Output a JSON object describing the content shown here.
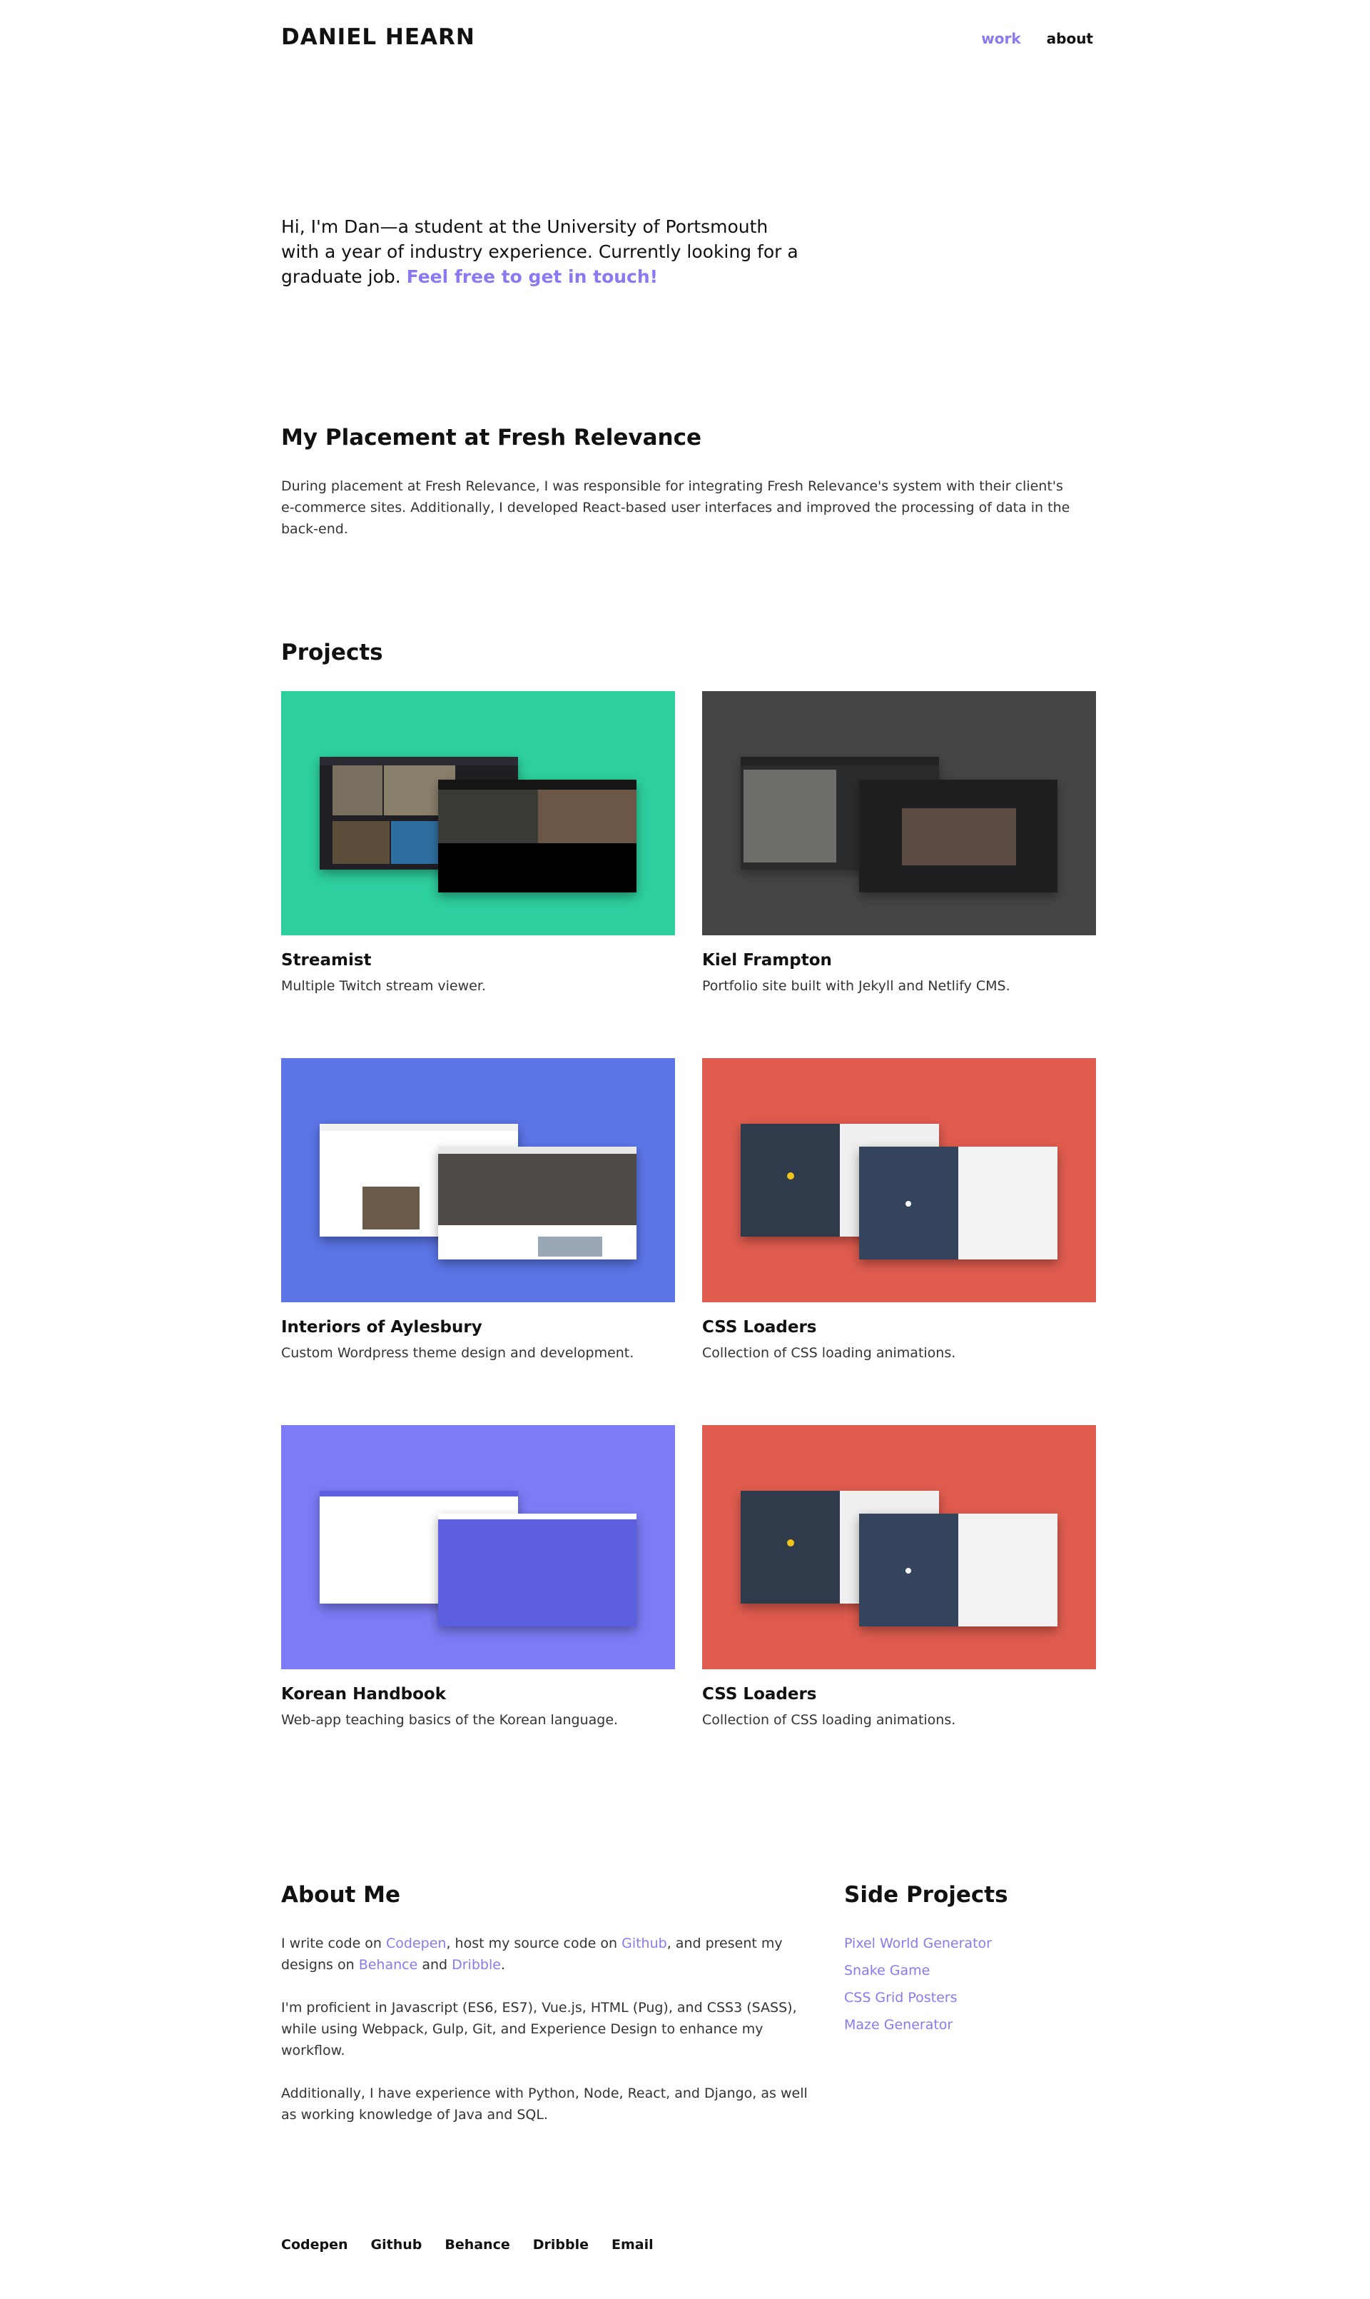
{
  "header": {
    "logo": "DANIEL HEARN",
    "nav": [
      {
        "label": "work",
        "active": true
      },
      {
        "label": "about",
        "active": false
      }
    ]
  },
  "intro": {
    "text": "Hi, I'm Dan—a student at the University of Portsmouth with a year of industry experience. Currently looking for a graduate job.",
    "cta": "Feel free to get in touch!"
  },
  "placement": {
    "heading": "My Placement at Fresh Relevance",
    "body": "During placement at Fresh Relevance, I was responsible for integrating Fresh Relevance's system with their client's e-commerce sites. Additionally, I developed React-based user interfaces and improved the processing of data in the back-end."
  },
  "projects": {
    "heading": "Projects",
    "items": [
      {
        "title": "Streamist",
        "desc": "Multiple Twitch stream viewer.",
        "bg": "#2ecf9e"
      },
      {
        "title": "Kiel Frampton",
        "desc": "Portfolio site built with Jekyll and Netlify CMS.",
        "bg": "#444547"
      },
      {
        "title": "Interiors of Aylesbury",
        "desc": "Custom Wordpress theme design and development.",
        "bg": "#5b75e6"
      },
      {
        "title": "CSS Loaders",
        "desc": "Collection of CSS loading animations.",
        "bg": "#e05c4f"
      },
      {
        "title": "Korean Handbook",
        "desc": "Web-app teaching basics of the Korean language.",
        "bg": "#7d7cf6"
      },
      {
        "title": "CSS Loaders",
        "desc": "Collection of CSS loading animations.",
        "bg": "#e05c4f"
      }
    ]
  },
  "about": {
    "heading": "About Me",
    "p1": {
      "t1": "I write code on ",
      "l1": "Codepen",
      "t2": ", host my source code on ",
      "l2": "Github",
      "t3": ", and present my designs on ",
      "l3": "Behance",
      "t4": " and ",
      "l4": "Dribble",
      "t5": "."
    },
    "p2": "I'm proficient in Javascript (ES6, ES7), Vue.js, HTML (Pug), and CSS3 (SASS), while using Webpack, Gulp, Git, and Experience Design to enhance my workflow.",
    "p3": "Additionally, I have experience with Python, Node, React, and Django, as well as working knowledge of Java and SQL."
  },
  "side_projects": {
    "heading": "Side Projects",
    "links": [
      "Pixel World Generator",
      "Snake Game",
      "CSS Grid Posters",
      "Maze Generator"
    ]
  },
  "footer": {
    "links": [
      "Codepen",
      "Github",
      "Behance",
      "Dribble",
      "Email"
    ]
  }
}
